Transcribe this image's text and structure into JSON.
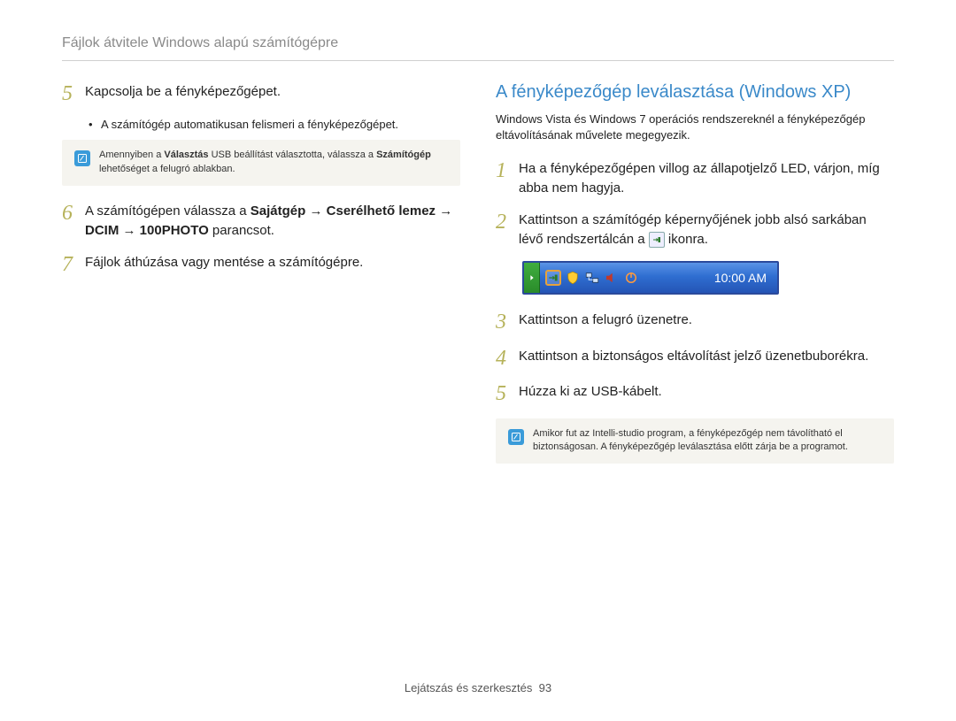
{
  "header": {
    "title": "Fájlok átvitele Windows alapú számítógépre"
  },
  "left": {
    "step5": {
      "num": "5",
      "text": "Kapcsolja be a fényképezőgépet."
    },
    "bullet5": "A számítógép automatikusan felismeri a fényképezőgépet.",
    "note1_pre": "Amennyiben a ",
    "note1_b1": "Választás",
    "note1_mid": " USB beállítást választotta, válassza a ",
    "note1_b2": "Számítógép",
    "note1_post": " lehetőséget a felugró ablakban.",
    "step6": {
      "num": "6",
      "pre": "A számítógépen válassza a ",
      "b1": "Sajátgép",
      "b2": "Cserélhető lemez",
      "b3": "DCIM",
      "b4": "100PHOTO",
      "post": " parancsot."
    },
    "step7": {
      "num": "7",
      "text": "Fájlok áthúzása vagy mentése a számítógépre."
    }
  },
  "right": {
    "title": "A fényképezőgép leválasztása (Windows XP)",
    "intro": "Windows Vista és Windows 7 operációs rendszereknél a fényképezőgép eltávolításának művelete megegyezik.",
    "step1": {
      "num": "1",
      "text": "Ha a fényképezőgépen villog az állapotjelző LED, várjon, míg abba nem hagyja."
    },
    "step2": {
      "num": "2",
      "pre": "Kattintson a számítógép képernyőjének jobb alsó sarkában lévő rendszertálcán a ",
      "post": " ikonra."
    },
    "taskbar_time": "10:00 AM",
    "step3": {
      "num": "3",
      "text": "Kattintson a felugró üzenetre."
    },
    "step4": {
      "num": "4",
      "text": "Kattintson a biztonságos eltávolítást jelző üzenetbuborékra."
    },
    "step5": {
      "num": "5",
      "text": "Húzza ki az USB-kábelt."
    },
    "note2": "Amikor fut az Intelli-studio program, a fényképezőgép nem távolítható el biztonságosan. A fényképezőgép leválasztása előtt zárja be a programot."
  },
  "footer": {
    "section": "Lejátszás és szerkesztés",
    "page": "93"
  },
  "glyphs": {
    "arrow": "→"
  }
}
